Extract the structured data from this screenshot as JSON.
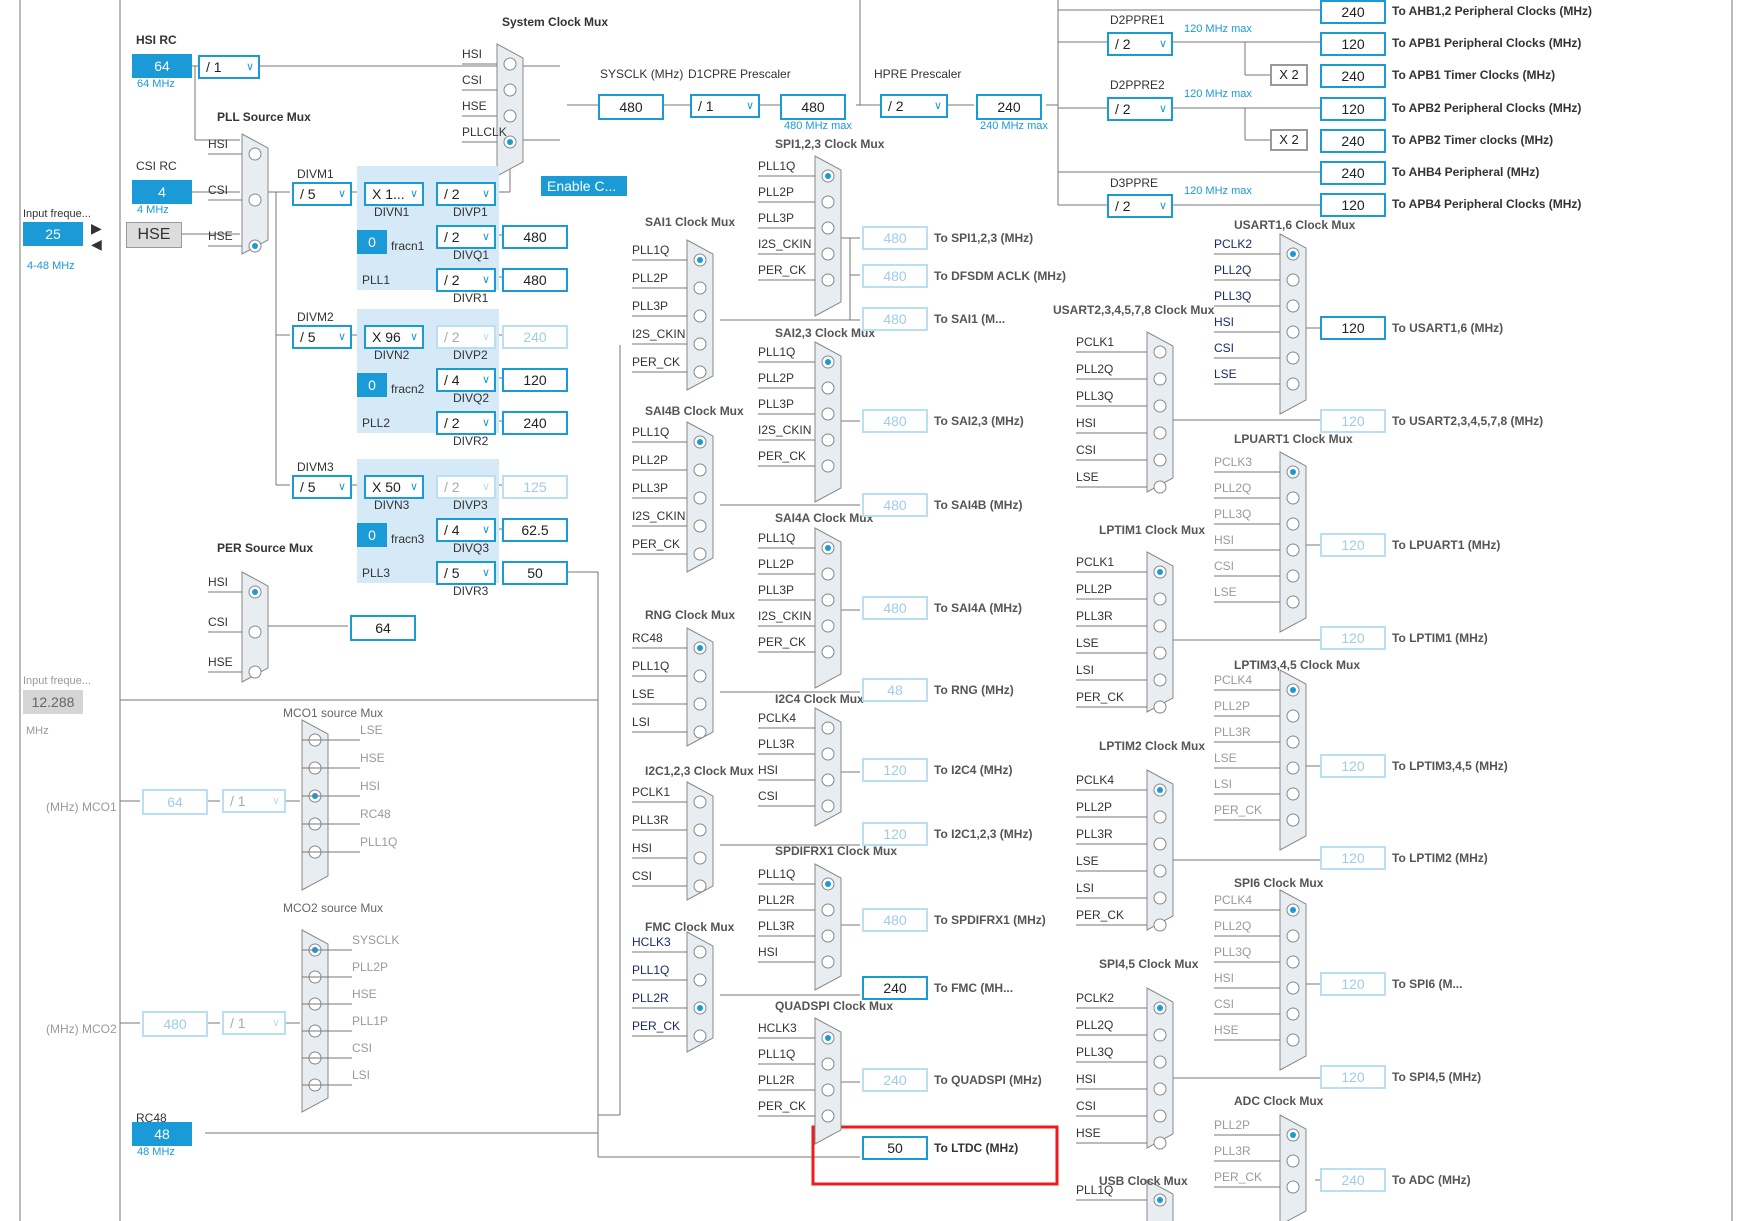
{
  "input_sources": {
    "hsi_label": "HSI RC",
    "hsi_value": "64",
    "hsi_freq": "64 MHz",
    "hsi_div": "/ 1",
    "csi_label": "CSI RC",
    "csi_value": "4",
    "csi_freq": "4 MHz",
    "input_freq_label": "Input freque...",
    "input_freq_value": "25",
    "input_freq_range": "4-48 MHz",
    "hse_label": "HSE",
    "lse_input_label": "Input freque...",
    "lse_input_value": "12.288",
    "lse_input_unit": "MHz",
    "rc48_label": "RC48",
    "rc48_value": "48",
    "rc48_freq": "48 MHz"
  },
  "system_clock_mux": {
    "title": "System Clock Mux",
    "inputs": [
      "HSI",
      "CSI",
      "HSE",
      "PLLCLK"
    ],
    "selected": "PLLCLK",
    "enable_button": "Enable C..."
  },
  "pll_source_mux": {
    "title": "PLL Source Mux",
    "inputs": [
      "HSI",
      "CSI",
      "HSE"
    ],
    "selected": "HSE"
  },
  "per_source_mux": {
    "title": "PER Source Mux",
    "inputs": [
      "HSI",
      "CSI",
      "HSE"
    ],
    "selected": "HSI",
    "output": "64"
  },
  "prescalers": {
    "sysclk_label": "SYSCLK (MHz)",
    "sysclk_value": "480",
    "d1cpre_label": "D1CPRE Prescaler",
    "d1cpre_value": "/ 1",
    "d1cpre_out": "480",
    "d1cpre_max": "480 MHz max",
    "hpre_label": "HPRE Prescaler",
    "hpre_value": "/ 2",
    "hpre_out": "240",
    "hpre_max": "240 MHz max",
    "d2ppre1_label": "D2PPRE1",
    "d2ppre1_value": "/ 2",
    "d2ppre1_max": "120 MHz max",
    "d2ppre2_label": "D2PPRE2",
    "d2ppre2_value": "/ 2",
    "d2ppre2_max": "120 MHz max",
    "d3ppre_label": "D3PPRE",
    "d3ppre_value": "/ 2",
    "d3ppre_max": "120 MHz max",
    "x2_label": "X 2"
  },
  "pll1": {
    "name": "PLL1",
    "divm_label": "DIVM1",
    "divm": "/ 5",
    "divn": "X 1...",
    "divn_label": "DIVN1",
    "fracn": "0",
    "fracn_label": "fracn1",
    "divp": "/ 2",
    "divp_label": "DIVP1",
    "divq": "/ 2",
    "divq_label": "DIVQ1",
    "divq_out": "480",
    "divr": "/ 2",
    "divr_label": "DIVR1",
    "divr_out": "480"
  },
  "pll2": {
    "name": "PLL2",
    "divm_label": "DIVM2",
    "divm": "/ 5",
    "divn": "X 96",
    "divn_label": "DIVN2",
    "fracn": "0",
    "fracn_label": "fracn2",
    "divp": "/ 2",
    "divp_label": "DIVP2",
    "divp_out": "240",
    "divq": "/ 4",
    "divq_label": "DIVQ2",
    "divq_out": "120",
    "divr": "/ 2",
    "divr_label": "DIVR2",
    "divr_out": "240"
  },
  "pll3": {
    "name": "PLL3",
    "divm_label": "DIVM3",
    "divm": "/ 5",
    "divn": "X 50",
    "divn_label": "DIVN3",
    "fracn": "0",
    "fracn_label": "fracn3",
    "divp": "/ 2",
    "divp_label": "DIVP3",
    "divp_out": "125",
    "divq": "/ 4",
    "divq_label": "DIVQ3",
    "divq_out": "62.5",
    "divr": "/ 5",
    "divr_label": "DIVR3",
    "divr_out": "50"
  },
  "bus_outputs": [
    {
      "value": "240",
      "label": "To AHB1,2 Peripheral Clocks (MHz)"
    },
    {
      "value": "120",
      "label": "To APB1 Peripheral Clocks (MHz)"
    },
    {
      "value": "240",
      "label": "To APB1 Timer Clocks (MHz)"
    },
    {
      "value": "120",
      "label": "To APB2 Peripheral Clocks (MHz)"
    },
    {
      "value": "240",
      "label": "To APB2 Timer clocks (MHz)"
    },
    {
      "value": "240",
      "label": "To AHB4 Peripheral (MHz)"
    },
    {
      "value": "120",
      "label": "To APB4 Peripheral Clocks (MHz)"
    }
  ],
  "mco1": {
    "title": "MCO1 source Mux",
    "inputs": [
      "LSE",
      "HSE",
      "HSI",
      "RC48",
      "PLL1Q"
    ],
    "value": "64",
    "div": "/ 1",
    "label": "(MHz) MCO1"
  },
  "mco2": {
    "title": "MCO2 source Mux",
    "inputs": [
      "SYSCLK",
      "PLL2P",
      "HSE",
      "PLL1P",
      "CSI",
      "LSI"
    ],
    "value": "480",
    "div": "/ 1",
    "label": "(MHz) MCO2"
  },
  "col1_muxes": [
    {
      "title": "SAI1 Clock Mux",
      "inputs": [
        "PLL1Q",
        "PLL2P",
        "PLL3P",
        "I2S_CKIN",
        "PER_CK"
      ]
    },
    {
      "title": "SAI4B Clock Mux",
      "inputs": [
        "PLL1Q",
        "PLL2P",
        "PLL3P",
        "I2S_CKIN",
        "PER_CK"
      ]
    },
    {
      "title": "RNG Clock Mux",
      "inputs": [
        "RC48",
        "PLL1Q",
        "LSE",
        "LSI"
      ]
    },
    {
      "title": "I2C1,2,3 Clock Mux",
      "inputs": [
        "PCLK1",
        "PLL3R",
        "HSI",
        "CSI"
      ]
    },
    {
      "title": "FMC Clock Mux",
      "inputs": [
        "HCLK3",
        "PLL1Q",
        "PLL2R",
        "PER_CK"
      ]
    }
  ],
  "col2_muxes": [
    {
      "title": "SPI1,2,3 Clock Mux",
      "inputs": [
        "PLL1Q",
        "PLL2P",
        "PLL3P",
        "I2S_CKIN",
        "PER_CK"
      ],
      "value": "480",
      "label": "To SPI1,2,3 (MHz)"
    },
    {
      "title": "",
      "inputs": [],
      "value": "480",
      "label": "To DFSDM ACLK (MHz)"
    },
    {
      "title": "",
      "inputs": [],
      "value": "480",
      "label": "To SAI1 (M..."
    },
    {
      "title": "SAI2,3 Clock Mux",
      "inputs": [
        "PLL1Q",
        "PLL2P",
        "PLL3P",
        "I2S_CKIN",
        "PER_CK"
      ],
      "value": "480",
      "label": "To SAI2,3 (MHz)"
    },
    {
      "title": "",
      "inputs": [],
      "value": "480",
      "label": "To SAI4B (MHz)"
    },
    {
      "title": "SAI4A Clock Mux",
      "inputs": [
        "PLL1Q",
        "PLL2P",
        "PLL3P",
        "I2S_CKIN",
        "PER_CK"
      ],
      "value": "480",
      "label": "To SAI4A (MHz)"
    },
    {
      "title": "",
      "inputs": [],
      "value": "48",
      "label": "To RNG (MHz)"
    },
    {
      "title": "I2C4 Clock Mux",
      "inputs": [
        "PCLK4",
        "PLL3R",
        "HSI",
        "CSI"
      ],
      "value": "120",
      "label": "To I2C4 (MHz)"
    },
    {
      "title": "",
      "inputs": [],
      "value": "120",
      "label": "To I2C1,2,3 (MHz)"
    },
    {
      "title": "SPDIFRX1 Clock Mux",
      "inputs": [
        "PLL1Q",
        "PLL2R",
        "PLL3R",
        "HSI"
      ],
      "value": "480",
      "label": "To SPDIFRX1 (MHz)"
    },
    {
      "title": "",
      "inputs": [],
      "value": "240",
      "label": "To FMC (MH..."
    },
    {
      "title": "QUADSPI Clock Mux",
      "inputs": [
        "HCLK3",
        "PLL1Q",
        "PLL2R",
        "PER_CK"
      ],
      "value": "240",
      "label": "To QUADSPI (MHz)"
    },
    {
      "title": "",
      "inputs": [],
      "value": "50",
      "label": "To LTDC (MHz)"
    }
  ],
  "col3_muxes": [
    {
      "title": "USART2,3,4,5,7,8 Clock Mux",
      "inputs": [
        "PCLK1",
        "PLL2Q",
        "PLL3Q",
        "HSI",
        "CSI",
        "LSE"
      ]
    },
    {
      "title": "LPTIM1 Clock Mux",
      "inputs": [
        "PCLK1",
        "PLL2P",
        "PLL3R",
        "LSE",
        "LSI",
        "PER_CK"
      ]
    },
    {
      "title": "LPTIM2 Clock Mux",
      "inputs": [
        "PCLK4",
        "PLL2P",
        "PLL3R",
        "LSE",
        "LSI",
        "PER_CK"
      ]
    },
    {
      "title": "SPI4,5 Clock Mux",
      "inputs": [
        "PCLK2",
        "PLL2Q",
        "PLL3Q",
        "HSI",
        "CSI",
        "HSE"
      ]
    },
    {
      "title": "USB Clock Mux",
      "inputs": [
        "PLL1Q"
      ]
    }
  ],
  "col4_muxes": [
    {
      "title": "USART1,6 Clock Mux",
      "inputs": [
        "PCLK2",
        "PLL2Q",
        "PLL3Q",
        "HSI",
        "CSI",
        "LSE"
      ],
      "value": "120",
      "label": "To USART1,6 (MHz)"
    },
    {
      "title": "",
      "inputs": [],
      "value": "120",
      "label": "To USART2,3,4,5,7,8 (MHz)"
    },
    {
      "title": "LPUART1 Clock Mux",
      "inputs": [
        "PCLK3",
        "PLL2Q",
        "PLL3Q",
        "HSI",
        "CSI",
        "LSE"
      ],
      "value": "120",
      "label": "To LPUART1 (MHz)"
    },
    {
      "title": "",
      "inputs": [],
      "value": "120",
      "label": "To LPTIM1 (MHz)"
    },
    {
      "title": "LPTIM3,4,5 Clock Mux",
      "inputs": [
        "PCLK4",
        "PLL2P",
        "PLL3R",
        "LSE",
        "LSI",
        "PER_CK"
      ],
      "value": "120",
      "label": "To LPTIM3,4,5 (MHz)"
    },
    {
      "title": "",
      "inputs": [],
      "value": "120",
      "label": "To LPTIM2 (MHz)"
    },
    {
      "title": "SPI6 Clock Mux",
      "inputs": [
        "PCLK4",
        "PLL2Q",
        "PLL3Q",
        "HSI",
        "CSI",
        "HSE"
      ],
      "value": "120",
      "label": "To SPI6 (M..."
    },
    {
      "title": "",
      "inputs": [],
      "value": "120",
      "label": "To SPI4,5 (MHz)"
    },
    {
      "title": "ADC Clock Mux",
      "inputs": [
        "PLL2P",
        "PLL3R",
        "PER_CK"
      ],
      "value": "240",
      "label": "To ADC (MHz)"
    }
  ],
  "colors": {
    "accent": "#1a9ad6",
    "highlight": "#ee1c1c",
    "disabled": "#9fcde8",
    "pll_panel": "#d6e9f7",
    "mux_fill": "#e8edf1"
  }
}
